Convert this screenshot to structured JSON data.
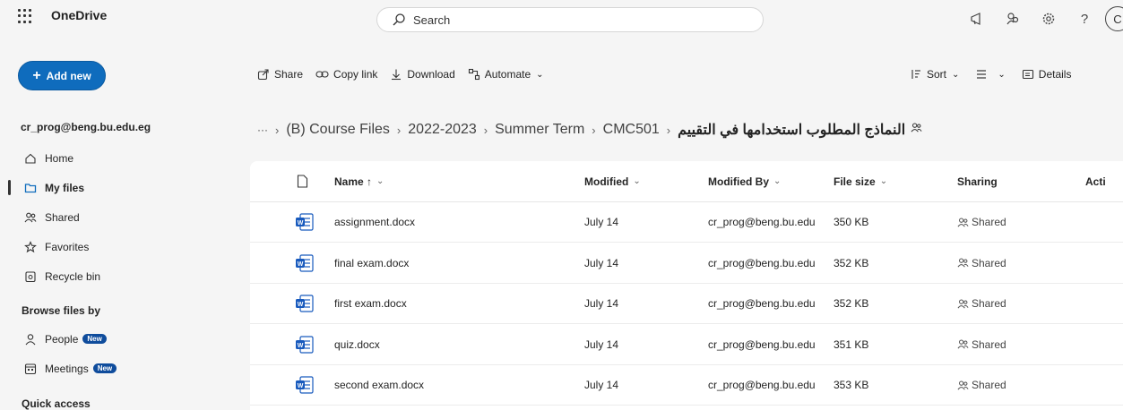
{
  "header": {
    "app_name": "OneDrive",
    "search_placeholder": "Search",
    "avatar_initial": "C"
  },
  "sidebar": {
    "add_new_label": "Add new",
    "account": "cr_prog@beng.bu.edu.eg",
    "nav_items": [
      {
        "label": "Home",
        "icon": "home-icon"
      },
      {
        "label": "My files",
        "icon": "folder-icon",
        "active": true
      },
      {
        "label": "Shared",
        "icon": "people-icon"
      },
      {
        "label": "Favorites",
        "icon": "star-icon"
      },
      {
        "label": "Recycle bin",
        "icon": "recycle-bin-icon"
      }
    ],
    "browse_title": "Browse files by",
    "browse_items": [
      {
        "label": "People",
        "badge": "New",
        "icon": "person-icon"
      },
      {
        "label": "Meetings",
        "badge": "New",
        "icon": "calendar-icon"
      }
    ],
    "quick_access_title": "Quick access"
  },
  "commands": {
    "share": "Share",
    "copy_link": "Copy link",
    "download": "Download",
    "automate": "Automate",
    "sort": "Sort",
    "details": "Details"
  },
  "breadcrumb": {
    "ellipsis": "···",
    "items": [
      "(B) Course Files",
      "2022-2023",
      "Summer Term",
      "CMC501"
    ],
    "current": "النماذج المطلوب استخدامها في التقييم"
  },
  "table": {
    "columns": {
      "name": "Name ↑",
      "modified": "Modified",
      "modified_by": "Modified By",
      "file_size": "File size",
      "sharing": "Sharing",
      "activity": "Acti"
    },
    "rows": [
      {
        "name": "assignment.docx",
        "modified": "July 14",
        "modified_by": "cr_prog@beng.bu.edu",
        "size": "350 KB",
        "sharing": "Shared"
      },
      {
        "name": "final exam.docx",
        "modified": "July 14",
        "modified_by": "cr_prog@beng.bu.edu",
        "size": "352 KB",
        "sharing": "Shared"
      },
      {
        "name": "first exam.docx",
        "modified": "July 14",
        "modified_by": "cr_prog@beng.bu.edu",
        "size": "352 KB",
        "sharing": "Shared"
      },
      {
        "name": "quiz.docx",
        "modified": "July 14",
        "modified_by": "cr_prog@beng.bu.edu",
        "size": "351 KB",
        "sharing": "Shared"
      },
      {
        "name": "second exam.docx",
        "modified": "July 14",
        "modified_by": "cr_prog@beng.bu.edu",
        "size": "353 KB",
        "sharing": "Shared"
      }
    ]
  },
  "colors": {
    "accent": "#0f6cbd",
    "word_blue": "#185abd",
    "badge": "#0f4c9c"
  }
}
